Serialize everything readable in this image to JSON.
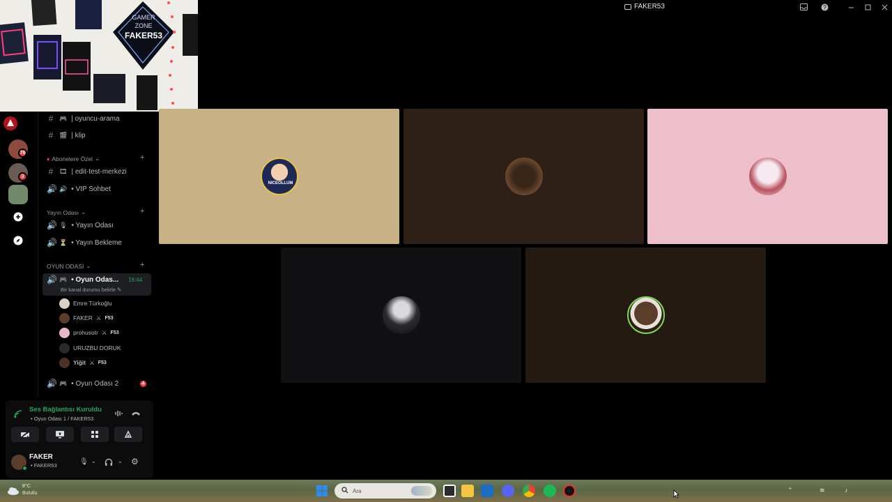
{
  "window": {
    "title": "FAKER53"
  },
  "webcam": {
    "poster_top": "GAMER",
    "poster_mid": "ZONE",
    "poster_name": "FAKER53"
  },
  "rail": {
    "servers": [
      {
        "badge": "76"
      },
      {
        "badge": "3"
      },
      {
        "badge": ""
      }
    ]
  },
  "channels": {
    "top": [
      {
        "symbol": "#",
        "label": "| oyuncu-arama"
      },
      {
        "symbol": "#",
        "label": "| klip"
      }
    ],
    "cat1": {
      "label": "Abonelere Özel"
    },
    "cat1_items": [
      {
        "symbol": "#",
        "label": "| edit-test-merkezi"
      },
      {
        "symbol": "🔊",
        "label": "• VIP Sohbet"
      }
    ],
    "cat2": {
      "label": "Yayın Odası"
    },
    "cat2_items": [
      {
        "symbol": "🔊",
        "label": "• Yayın Odası"
      },
      {
        "symbol": "🔊",
        "label": "• Yayın Bekleme"
      }
    ],
    "cat3": {
      "label": "OYUN ODASI"
    },
    "active": {
      "label": "• Oyun Odas...",
      "timer": "16:44",
      "status": "Bir kanal durumu belirle"
    },
    "members": [
      {
        "name": "Emre Türkoğlu",
        "tag": ""
      },
      {
        "name": "FAKER",
        "tag": "F53"
      },
      {
        "name": "prohusotr",
        "tag": "F53"
      },
      {
        "name": "URUZBU DORUK",
        "tag": ""
      },
      {
        "name": "Yiğit",
        "tag": "F53"
      }
    ],
    "next": {
      "label": "• Oyun Odası 2",
      "badge": "4"
    }
  },
  "voice": {
    "status": "Ses Bağlantısı Kuruldu",
    "channel": "• Oyun Odası 1 / FAKER53"
  },
  "user": {
    "name": "FAKER",
    "status": "• FAKER53"
  },
  "tiles": [
    {
      "color": "#c8b285",
      "label": "NICEOLLUM"
    },
    {
      "color": "#2e1f17",
      "label": ""
    },
    {
      "color": "#ecbfcb",
      "label": ""
    },
    {
      "color": "#111114",
      "label": ""
    },
    {
      "color": "#251a12",
      "label": ""
    }
  ],
  "taskbar": {
    "search_placeholder": "Ara",
    "weather_temp": "8°C",
    "weather_text": "Bulutlu"
  },
  "colors": {
    "accent_green": "#23a55a",
    "danger": "#f23f43",
    "panel": "#1e1f22"
  }
}
